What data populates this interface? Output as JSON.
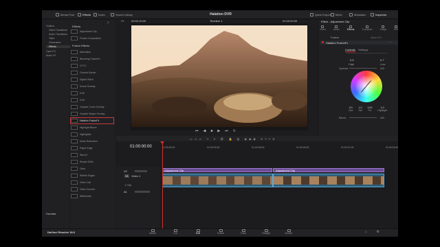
{
  "topbar": {
    "buttons": [
      {
        "label": "Media Pool",
        "active": false
      },
      {
        "label": "Effects",
        "active": true
      },
      {
        "label": "Index",
        "active": false
      },
      {
        "label": "Sound Library",
        "active": false
      }
    ],
    "project_title": "Halation DVR",
    "right_buttons": [
      {
        "label": "Quick Export",
        "active": false
      },
      {
        "label": "Mixer",
        "active": false
      },
      {
        "label": "Metadata",
        "active": false
      },
      {
        "label": "Inspector",
        "active": true
      }
    ]
  },
  "sidebar": {
    "items": [
      {
        "label": "Toolbox",
        "sel": false,
        "indent": 0
      },
      {
        "label": "Video Transitions",
        "sel": false,
        "indent": 1
      },
      {
        "label": "Audio Transitions",
        "sel": false,
        "indent": 1
      },
      {
        "label": "Titles",
        "sel": false,
        "indent": 1
      },
      {
        "label": "Generators",
        "sel": false,
        "indent": 1
      },
      {
        "label": "Effects",
        "sel": true,
        "indent": 1
      },
      {
        "label": "Open FX",
        "sel": false,
        "indent": 0
      },
      {
        "label": "Audio FX",
        "sel": false,
        "indent": 0
      }
    ],
    "favorites_label": "Favorites"
  },
  "effects_list": {
    "header": "Effects",
    "items_a": [
      "Adjustment Clip",
      "Fusion Composition"
    ],
    "section_title": "Fusion Effects",
    "items_b": [
      "Aberration",
      "Blooming FusionFx",
      "CCTV",
      "Colored Border",
      "Digital Glitch",
      "Drone Overlay",
      "DVE",
      "DVE",
      "Graphic Curve Overlay",
      "Graphic Shape Overlay",
      "Halation FusionFx",
      "Highlight Bloom",
      "Highlighter",
      "Noise Reduction",
      "Paper Edge",
      "Stencil",
      "Simple Grille",
      "Glow",
      "Stretch Edges",
      "Video Call",
      "Video Corners",
      "Watermark"
    ],
    "selected_index": 10
  },
  "viewer": {
    "fit_label": "Fit",
    "timecode_left": "00:00:10:00",
    "timeline_name": "Timeline 1",
    "timecode_right": "01:00:00:00"
  },
  "inspector": {
    "title": "Effect - Adjustment Clip",
    "tabs": [
      "Video",
      "Audio",
      "Effects",
      "Transition",
      "Image",
      "File"
    ],
    "active_tab": "Effects",
    "subtabs": [
      "Fusion",
      "Open FX"
    ],
    "effect_name": "Halation FusionFx",
    "controls_tabs": [
      "Controls",
      "Settings"
    ],
    "params": [
      {
        "label": "High",
        "value": "0.5"
      },
      {
        "label": "Low",
        "value": "0.7"
      },
      {
        "label": "Spread",
        "value": "1.0"
      }
    ],
    "color_row": [
      {
        "label": "Hue",
        "value": "0.0"
      },
      {
        "label": "Sat",
        "value": "1.0"
      },
      {
        "label": "Thr",
        "value": "0.00"
      },
      {
        "label": "Highlight",
        "value": "1.0"
      }
    ],
    "blend_label": "Blend",
    "blend_value": "1.0"
  },
  "timeline": {
    "timecode": "01:00:00:00",
    "ruler": [
      "01:00:00:00",
      "01:00:03:00",
      "01:00:06:00",
      "01:00:09:00",
      "01:00:12:00",
      "01:00:15:00"
    ],
    "tracks": [
      {
        "id": "V2",
        "name": ""
      },
      {
        "id": "V1",
        "name": "Video 1"
      },
      {
        "id": "A1",
        "name": ""
      }
    ],
    "clip_count": "1 Clip",
    "adjustment_clips": [
      "Adjustment Clip",
      "Adjustment Clip"
    ]
  },
  "pages": [
    {
      "label": "Media",
      "active": false
    },
    {
      "label": "Cut",
      "active": false
    },
    {
      "label": "Edit",
      "active": true
    },
    {
      "label": "Fusion",
      "active": false
    },
    {
      "label": "Color",
      "active": false
    },
    {
      "label": "Fairlight",
      "active": false
    },
    {
      "label": "Deliver",
      "active": false
    }
  ],
  "brand": "DaVinci Resolve 18.6",
  "colors": {
    "accent_red": "#d2322d",
    "clip_blue": "#5fa9d4",
    "audio_green": "#3b9c63"
  }
}
